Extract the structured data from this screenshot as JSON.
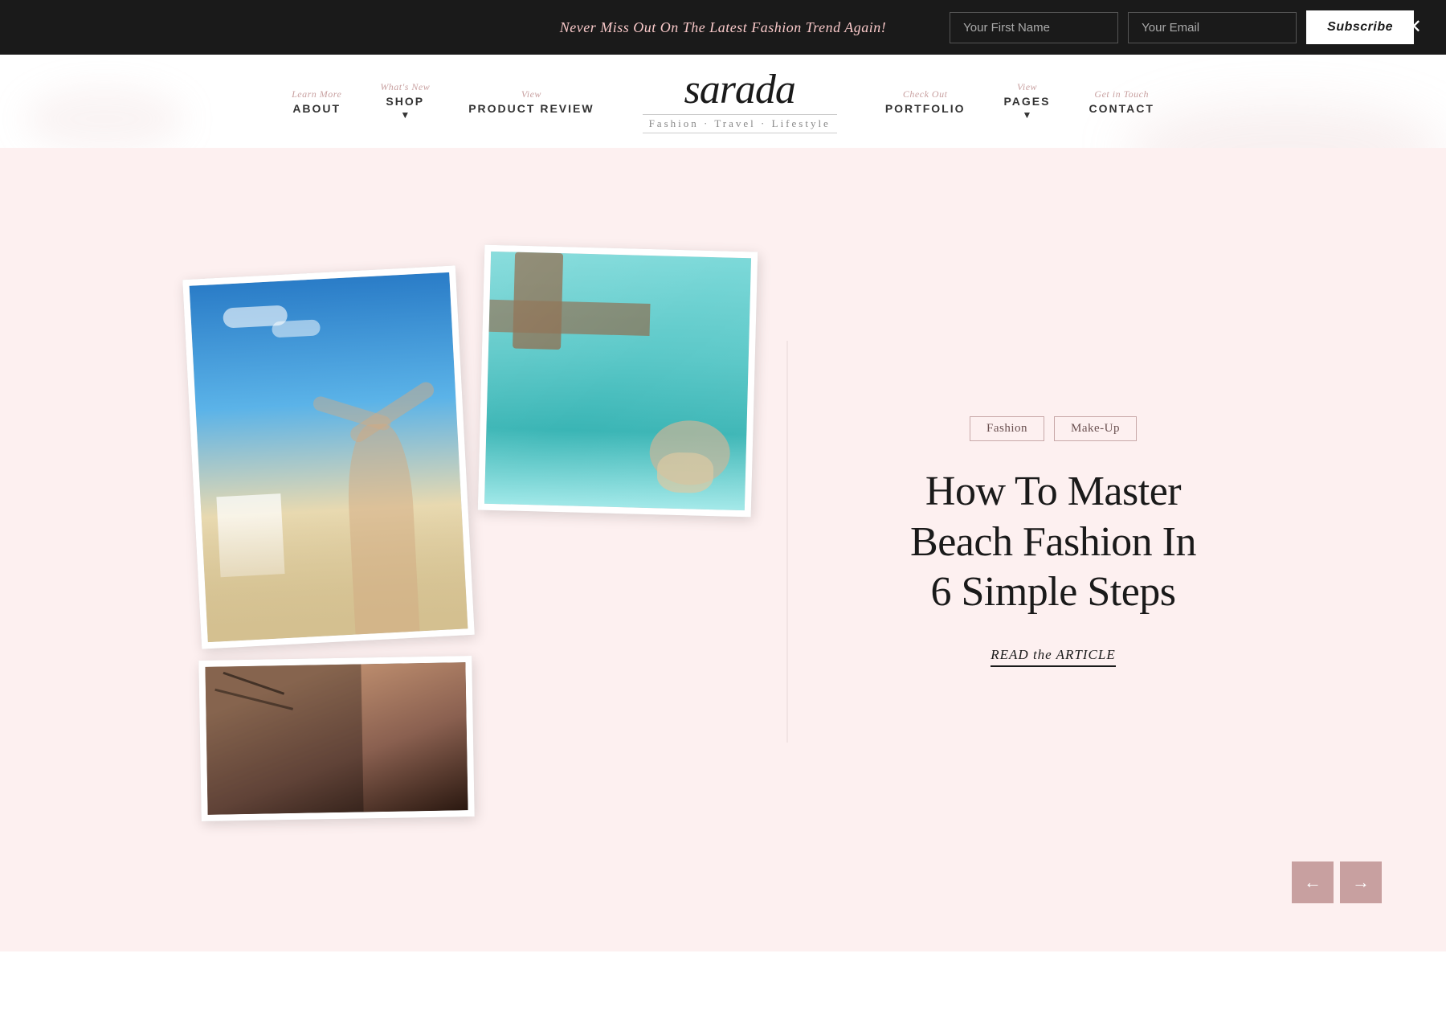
{
  "banner": {
    "text": "Never Miss Out On The Latest Fashion Trend Again!",
    "first_name_placeholder": "Your First Name",
    "email_placeholder": "Your Email",
    "subscribe_label": "Subscribe"
  },
  "nav": {
    "left": [
      {
        "hint": "Learn More",
        "label": "ABOUT",
        "has_arrow": false
      },
      {
        "hint": "What's New",
        "label": "SHOP",
        "has_arrow": true
      },
      {
        "hint": "View",
        "label": "PRODUCT REVIEW",
        "has_arrow": false
      }
    ],
    "right": [
      {
        "hint": "Check Out",
        "label": "PORTFOLIO",
        "has_arrow": false
      },
      {
        "hint": "View",
        "label": "PAGES",
        "has_arrow": true
      },
      {
        "hint": "Get in Touch",
        "label": "CONTACT",
        "has_arrow": false
      }
    ],
    "logo": "sarada",
    "logo_tagline": "Fashion · Travel · Lifestyle"
  },
  "hero": {
    "tags": [
      "Fashion",
      "Make-Up"
    ],
    "title": "How To Master Beach Fashion In 6 Simple Steps",
    "read_article": "READ the ARTICLE"
  },
  "arrows": {
    "prev": "←",
    "next": "→"
  }
}
